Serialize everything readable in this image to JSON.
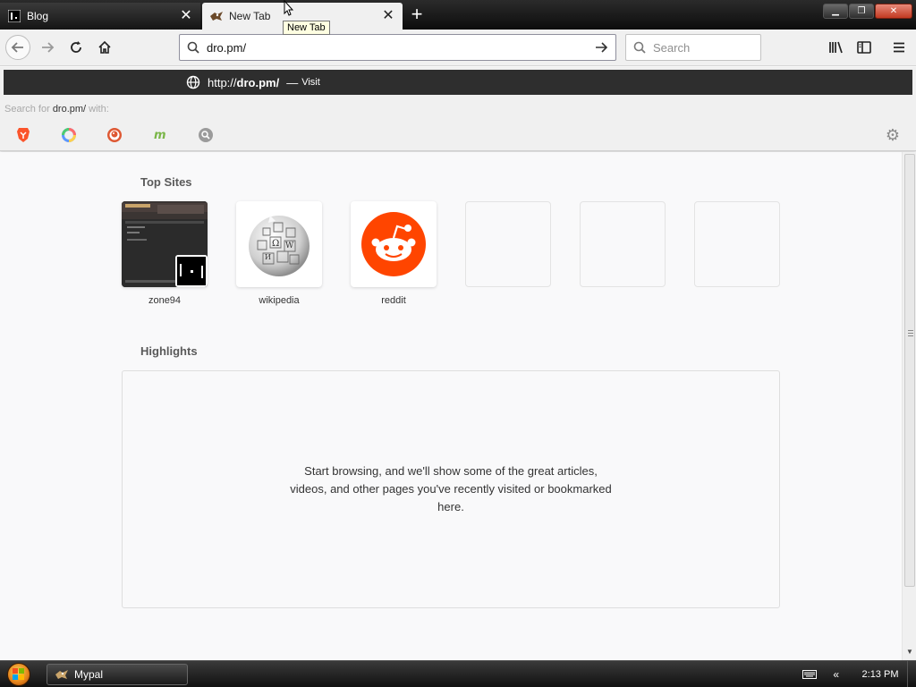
{
  "tabs": [
    {
      "title": "Blog",
      "favicon": "blog-favicon",
      "active": false,
      "close_label": "✕"
    },
    {
      "title": "New Tab",
      "favicon": "mypal-favicon",
      "active": true,
      "close_label": "✕"
    }
  ],
  "new_tab_button_label": "+",
  "tooltip": "New Tab",
  "window_controls": {
    "minimize": "▁",
    "maximize": "❐",
    "close": "✕"
  },
  "navbar": {
    "url": "dro.pm/",
    "search_placeholder": "Search"
  },
  "dropdown": {
    "visit_url_prefix": "http://",
    "visit_url_bold": "dro.pm/",
    "visit_dash": "—",
    "visit_label": "Visit",
    "search_for_prefix": "Search for ",
    "search_for_term": "dro.pm/",
    "search_for_suffix": " with:",
    "engines": [
      "brave-icon",
      "qwant-icon",
      "duckduckgo-icon",
      "mojeek-icon",
      "search-engine-icon"
    ]
  },
  "top_sites": {
    "title": "Top Sites",
    "sites": [
      {
        "label": "zone94",
        "thumb": "zone94-thumbnail"
      },
      {
        "label": "wikipedia",
        "thumb": "wikipedia-logo"
      },
      {
        "label": "reddit",
        "thumb": "reddit-logo"
      },
      {
        "label": "",
        "thumb": "empty"
      },
      {
        "label": "",
        "thumb": "empty"
      },
      {
        "label": "",
        "thumb": "empty"
      }
    ]
  },
  "highlights": {
    "title": "Highlights",
    "empty_message": "Start browsing, and we'll show some of the great articles, videos, and other pages you've recently visited or bookmarked here."
  },
  "taskbar": {
    "task_label": "Mypal",
    "tray_chevron": "«",
    "clock": "2:13 PM"
  },
  "colors": {
    "accent_dark": "#2e2e2e",
    "reddit_orange": "#ff4500",
    "page_bg": "#f9f9fa"
  }
}
